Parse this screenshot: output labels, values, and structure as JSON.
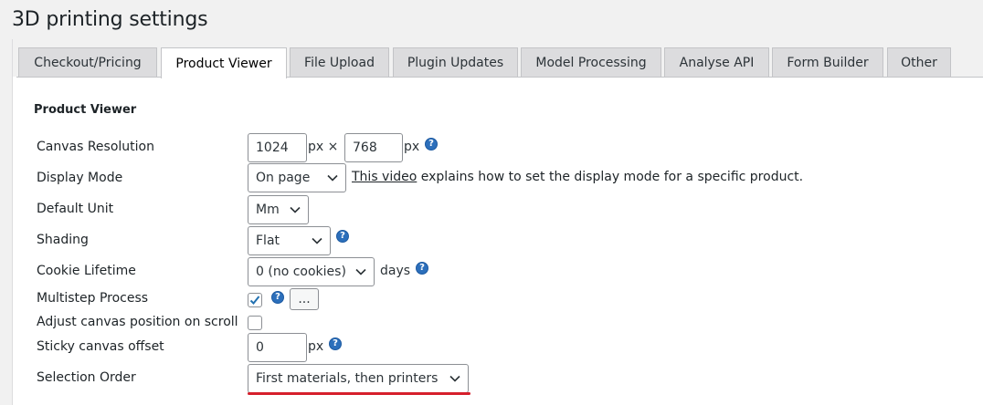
{
  "page": {
    "title": "3D printing settings"
  },
  "tabs": [
    {
      "label": "Checkout/Pricing",
      "active": false
    },
    {
      "label": "Product Viewer",
      "active": true
    },
    {
      "label": "File Upload",
      "active": false
    },
    {
      "label": "Plugin Updates",
      "active": false
    },
    {
      "label": "Model Processing",
      "active": false
    },
    {
      "label": "Analyse API",
      "active": false
    },
    {
      "label": "Form Builder",
      "active": false
    },
    {
      "label": "Other",
      "active": false
    }
  ],
  "section": {
    "title": "Product Viewer"
  },
  "settings": {
    "canvas_resolution": {
      "label": "Canvas Resolution",
      "width": "1024",
      "height": "768",
      "unit": "px",
      "times": "px ×"
    },
    "display_mode": {
      "label": "Display Mode",
      "value": "On page",
      "link_text": "This video",
      "note": "explains how to set the display mode for a specific product."
    },
    "default_unit": {
      "label": "Default Unit",
      "value": "Mm"
    },
    "shading": {
      "label": "Shading",
      "value": "Flat"
    },
    "cookie_lifetime": {
      "label": "Cookie Lifetime",
      "value": "0 (no cookies)",
      "suffix": "days"
    },
    "multistep_process": {
      "label": "Multistep Process",
      "checked": true,
      "button": "..."
    },
    "adjust_canvas": {
      "label": "Adjust canvas position on scroll",
      "checked": false
    },
    "sticky_offset": {
      "label": "Sticky canvas offset",
      "value": "0",
      "unit": "px"
    },
    "selection_order": {
      "label": "Selection Order",
      "value": "First materials, then printers"
    }
  },
  "icons": {
    "help": "?"
  },
  "colors": {
    "accent": "#2271b1",
    "help_icon": "#2c6fbb",
    "highlight": "#d61f2c"
  }
}
